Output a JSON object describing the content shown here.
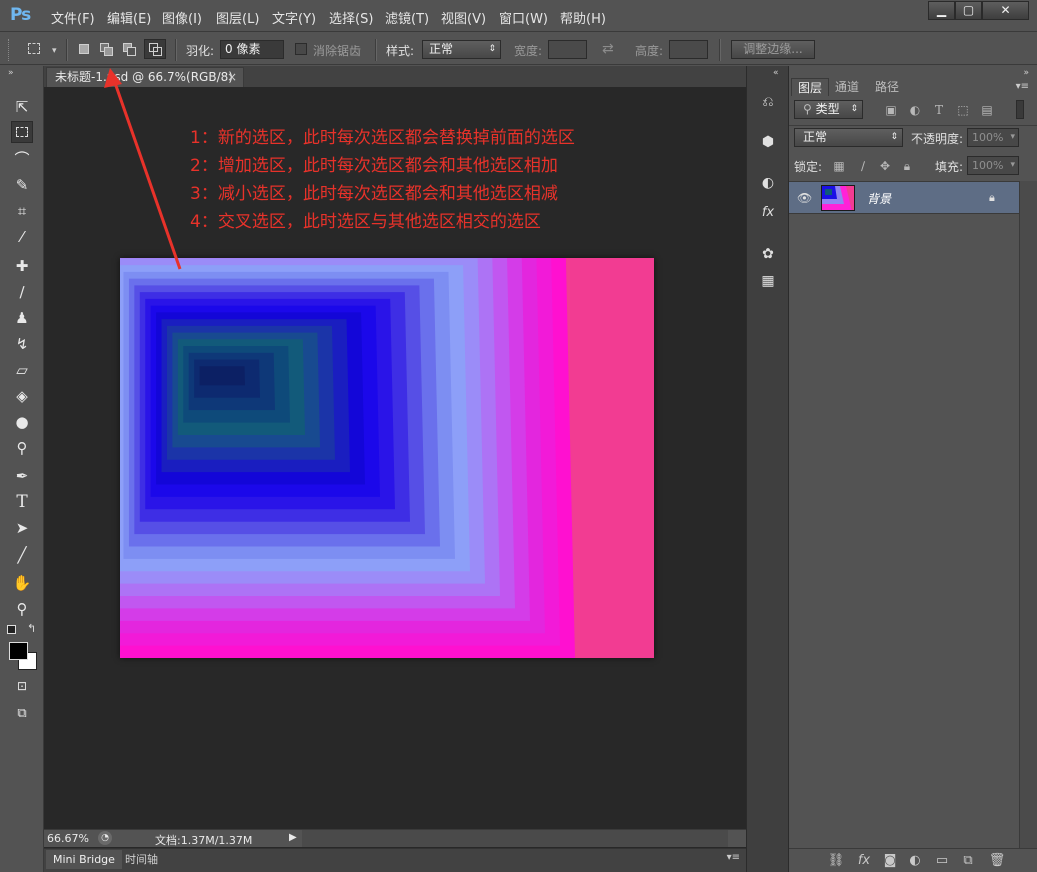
{
  "app": {
    "logo": "Ps"
  },
  "menu": [
    "文件(F)",
    "编辑(E)",
    "图像(I)",
    "图层(L)",
    "文字(Y)",
    "选择(S)",
    "滤镜(T)",
    "视图(V)",
    "窗口(W)",
    "帮助(H)"
  ],
  "window_controls": {
    "minimize": "▁",
    "maximize": "▢",
    "close": "✕"
  },
  "options": {
    "feather_label": "羽化:",
    "feather_value": "0 像素",
    "antialias_label": "消除锯齿",
    "style_label": "样式:",
    "style_value": "正常",
    "width_label": "宽度:",
    "height_label": "高度:",
    "refine_edge": "调整边缘..."
  },
  "document": {
    "tab_title": "未标题-1.psd @ 66.7%(RGB/8)",
    "tab_close": "×"
  },
  "annotations": [
    "1：新的选区，此时每次选区都会替换掉前面的选区",
    "2：增加选区，此时每次选区都会和其他选区相加",
    "3：减小选区，此时每次选区都会和其他选区相减",
    "4：交叉选区，此时选区与其他选区相交的选区"
  ],
  "status": {
    "zoom": "66.67%",
    "doc_info": "文档:1.37M/1.37M"
  },
  "bottom_tabs": [
    "Mini Bridge",
    "时间轴"
  ],
  "layers_panel": {
    "tabs": [
      "图层",
      "通道",
      "路径"
    ],
    "filter_kind": "类型",
    "blend_mode": "正常",
    "opacity_label": "不透明度:",
    "opacity_value": "100%",
    "lock_label": "锁定:",
    "fill_label": "填充:",
    "fill_value": "100%",
    "layer_name": "背景"
  },
  "colors": {
    "annotation_red": "#e8322a",
    "selected_layer": "#5e6d85",
    "canvas_bg": "#282828"
  }
}
